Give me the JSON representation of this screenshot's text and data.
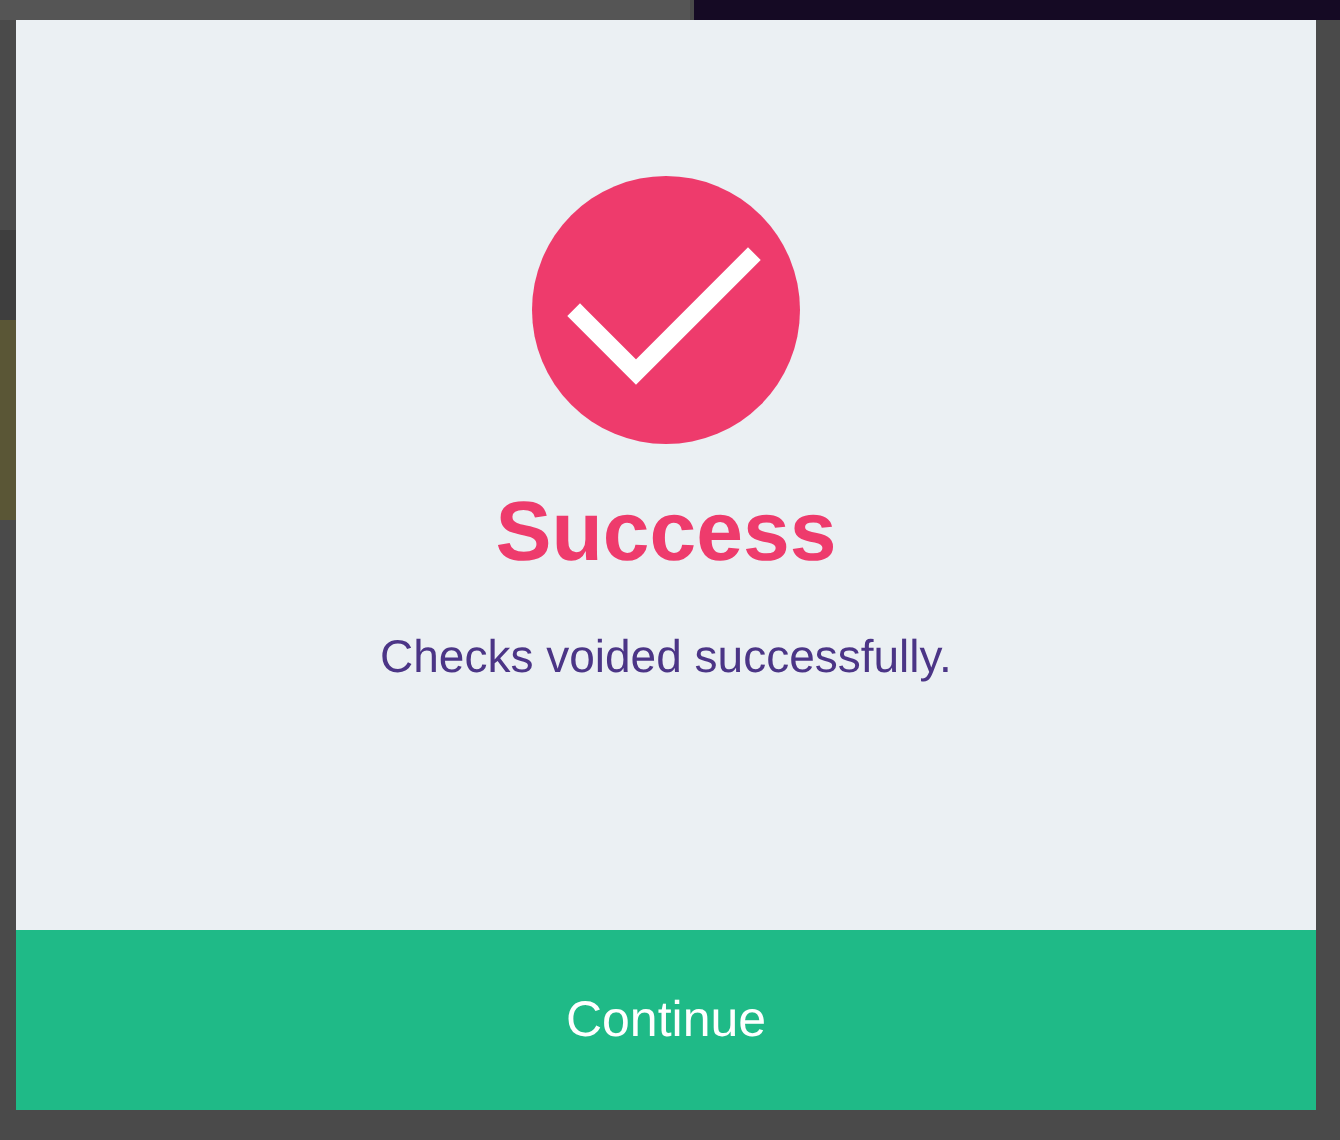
{
  "dialog": {
    "success": true,
    "title": "Success",
    "message": "Checks voided successfully.",
    "button": "Continue"
  }
}
